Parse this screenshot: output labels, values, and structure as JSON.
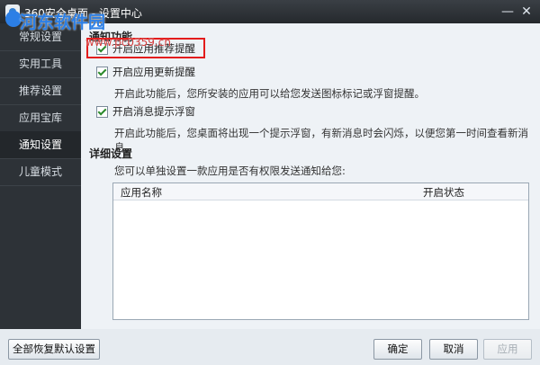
{
  "window": {
    "title": "360安全桌面 - 设置中心",
    "min_icon": "minimize-icon",
    "close_icon": "close-icon"
  },
  "watermark": {
    "text": "河东软件园",
    "url": "www.pc0359.cn"
  },
  "sidebar": {
    "items": [
      {
        "label": "常规设置",
        "active": false
      },
      {
        "label": "实用工具",
        "active": false
      },
      {
        "label": "推荐设置",
        "active": false
      },
      {
        "label": "应用宝库",
        "active": false
      },
      {
        "label": "通知设置",
        "active": true
      },
      {
        "label": "儿童模式",
        "active": false
      }
    ]
  },
  "notify": {
    "section_title": "通知功能",
    "options": [
      {
        "label": "开启应用推荐提醒",
        "checked": true
      },
      {
        "label": "开启应用更新提醒",
        "checked": true,
        "desc": "开启此功能后，您所安装的应用可以给您发送图标标记或浮窗提醒。"
      },
      {
        "label": "开启消息提示浮窗",
        "checked": true,
        "desc": "开启此功能后，您桌面将出现一个提示浮窗，有新消息时会闪烁，以便您第一时间查看新消息。"
      }
    ]
  },
  "detail": {
    "section_title": "详细设置",
    "desc": "您可以单独设置一款应用是否有权限发送通知给您:",
    "columns": {
      "name": "应用名称",
      "status": "开启状态"
    }
  },
  "footer": {
    "reset_label": "全部恢复默认设置",
    "ok_label": "确定",
    "cancel_label": "取消",
    "apply_label": "应用"
  }
}
